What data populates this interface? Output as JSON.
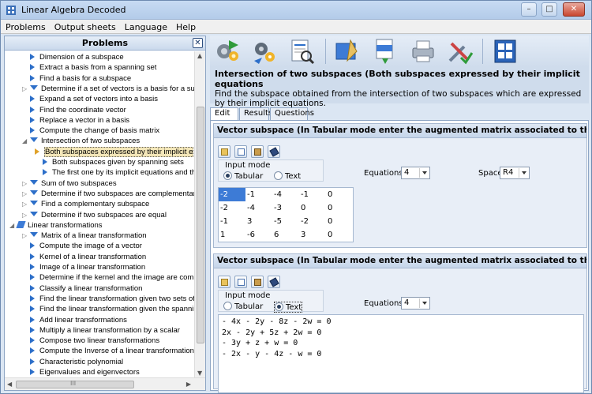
{
  "window": {
    "title": "Linear Algebra Decoded"
  },
  "menu": [
    "Problems",
    "Output sheets",
    "Language",
    "Help"
  ],
  "problems_panel": {
    "title": "Problems",
    "items": [
      {
        "label": "Dimension of a subspace",
        "indent": 2,
        "kind": "leaf"
      },
      {
        "label": "Extract a basis from a spanning set",
        "indent": 2,
        "kind": "leaf"
      },
      {
        "label": "Find a basis for a subspace",
        "indent": 2,
        "kind": "leaf"
      },
      {
        "label": "Determine if a set of vectors is a basis for a sub",
        "indent": 2,
        "kind": "group"
      },
      {
        "label": "Expand a set of vectors into a basis",
        "indent": 2,
        "kind": "leaf"
      },
      {
        "label": "Find the coordinate vector",
        "indent": 2,
        "kind": "leaf"
      },
      {
        "label": "Replace a vector in a basis",
        "indent": 2,
        "kind": "leaf"
      },
      {
        "label": "Compute the change of basis matrix",
        "indent": 2,
        "kind": "leaf"
      },
      {
        "label": "Intersection of two subspaces",
        "indent": 2,
        "kind": "open"
      },
      {
        "label": "Both subspaces expressed by their implicit e",
        "indent": 3,
        "kind": "selected"
      },
      {
        "label": "Both subspaces given by spanning sets",
        "indent": 3,
        "kind": "leaf"
      },
      {
        "label": "The first one by its implicit equations and th",
        "indent": 3,
        "kind": "leaf"
      },
      {
        "label": "Sum of two subspaces",
        "indent": 2,
        "kind": "group"
      },
      {
        "label": "Determine if two subspaces are complementary",
        "indent": 2,
        "kind": "group"
      },
      {
        "label": "Find a complementary subspace",
        "indent": 2,
        "kind": "group"
      },
      {
        "label": "Determine if two subspaces are equal",
        "indent": 2,
        "kind": "group"
      },
      {
        "label": "Linear transformations",
        "indent": 1,
        "kind": "category"
      },
      {
        "label": "Matrix of a linear transformation",
        "indent": 2,
        "kind": "group"
      },
      {
        "label": "Compute the image of a vector",
        "indent": 2,
        "kind": "leaf"
      },
      {
        "label": "Kernel of a linear transformation",
        "indent": 2,
        "kind": "leaf"
      },
      {
        "label": "Image of a linear transformation",
        "indent": 2,
        "kind": "leaf"
      },
      {
        "label": "Determine if the kernel and the image are compl",
        "indent": 2,
        "kind": "leaf"
      },
      {
        "label": "Classify a linear transformation",
        "indent": 2,
        "kind": "leaf"
      },
      {
        "label": "Find the linear transformation given two sets of",
        "indent": 2,
        "kind": "leaf"
      },
      {
        "label": "Find the linear transformation given the spannin",
        "indent": 2,
        "kind": "leaf"
      },
      {
        "label": "Add linear transformations",
        "indent": 2,
        "kind": "leaf"
      },
      {
        "label": "Multiply a linear transformation by a scalar",
        "indent": 2,
        "kind": "leaf"
      },
      {
        "label": "Compose two linear transformations",
        "indent": 2,
        "kind": "leaf"
      },
      {
        "label": "Compute the Inverse of a linear transformation",
        "indent": 2,
        "kind": "leaf"
      },
      {
        "label": "Characteristic polynomial",
        "indent": 2,
        "kind": "leaf"
      },
      {
        "label": "Eigenvalues and eigenvectors",
        "indent": 2,
        "kind": "leaf"
      }
    ],
    "scroll_mark": "III"
  },
  "problem": {
    "heading": "Intersection of two subspaces (Both subspaces expressed by their implicit equations",
    "description": "Find the subspace obtained from the intersection of two subspaces which are expressed by their implicit equations."
  },
  "tabs": [
    "Edit",
    "Results",
    "Questions"
  ],
  "subspace1": {
    "heading": "Vector subspace (In Tabular mode enter the augmented matrix associated to the implicit eq",
    "input_mode_label": "Input mode",
    "mode_tabular": "Tabular",
    "mode_text": "Text",
    "equations_label": "Equations",
    "equations_value": "4",
    "space_label": "Space",
    "space_value": "R4",
    "matrix": [
      [
        "-2",
        "-1",
        "-4",
        "-1",
        "0"
      ],
      [
        "-2",
        "-4",
        "-3",
        "0",
        "0"
      ],
      [
        "-1",
        "3",
        "-5",
        "-2",
        "0"
      ],
      [
        "1",
        "-6",
        "6",
        "3",
        "0"
      ]
    ]
  },
  "subspace2": {
    "heading": "Vector subspace (In Tabular mode enter the augmented matrix associated to the implicit e",
    "input_mode_label": "Input mode",
    "mode_tabular": "Tabular",
    "mode_text": "Text",
    "equations_label": "Equations",
    "equations_value": "4",
    "text_lines": "- 4x - 2y - 8z - 2w = 0\n2x - 2y + 5z + 2w = 0\n- 3y + z + w = 0\n- 2x - y - 4z - w = 0"
  }
}
